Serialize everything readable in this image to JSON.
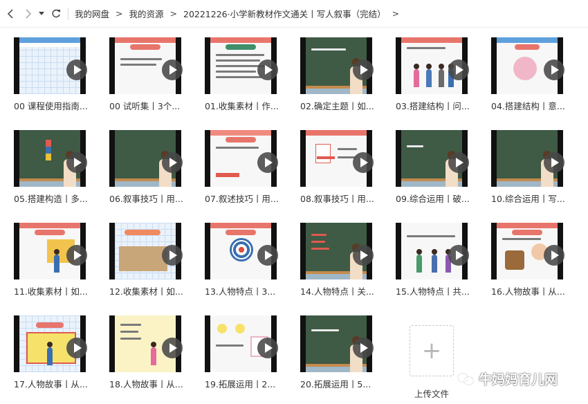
{
  "toolbar": {
    "back_icon": "chevron-left-icon",
    "forward_icon": "chevron-right-icon",
    "history_icon": "caret-down-icon",
    "refresh_icon": "refresh-icon"
  },
  "breadcrumb": {
    "items": [
      "我的网盘",
      "我的资源",
      "20221226·小学新教材作文通关丨写人叙事（完结）"
    ],
    "separator": ">"
  },
  "files": [
    {
      "label": "00 课程使用指南..."
    },
    {
      "label": "00 试听集丨3个..."
    },
    {
      "label": "01.收集素材丨作..."
    },
    {
      "label": "02.确定主题丨如..."
    },
    {
      "label": "03.搭建结构丨问..."
    },
    {
      "label": "04.搭建结构丨意..."
    },
    {
      "label": "05.搭建构造丨多..."
    },
    {
      "label": "06.叙事技巧丨用..."
    },
    {
      "label": "07.叙述技巧丨用..."
    },
    {
      "label": "08.叙事技巧丨用..."
    },
    {
      "label": "09.综合运用丨破..."
    },
    {
      "label": "10.综合运用丨写..."
    },
    {
      "label": "11.收集素材丨如..."
    },
    {
      "label": "12.收集素材丨如..."
    },
    {
      "label": "13.人物特点丨3..."
    },
    {
      "label": "14.人物特点丨关..."
    },
    {
      "label": "15.人物特点丨共..."
    },
    {
      "label": "16.人物故事丨从..."
    },
    {
      "label": "17.人物故事丨从..."
    },
    {
      "label": "18.人物故事丨从..."
    },
    {
      "label": "19.拓展运用丨2..."
    },
    {
      "label": "20.拓展运用丨5..."
    }
  ],
  "upload": {
    "label": "上传文件",
    "icon": "plus-icon"
  },
  "watermark": {
    "text": "牛妈妈育儿网"
  },
  "colors": {
    "accent_red": "#e8756b",
    "board_green": "#3f5a45",
    "play_overlay": "#484848"
  }
}
